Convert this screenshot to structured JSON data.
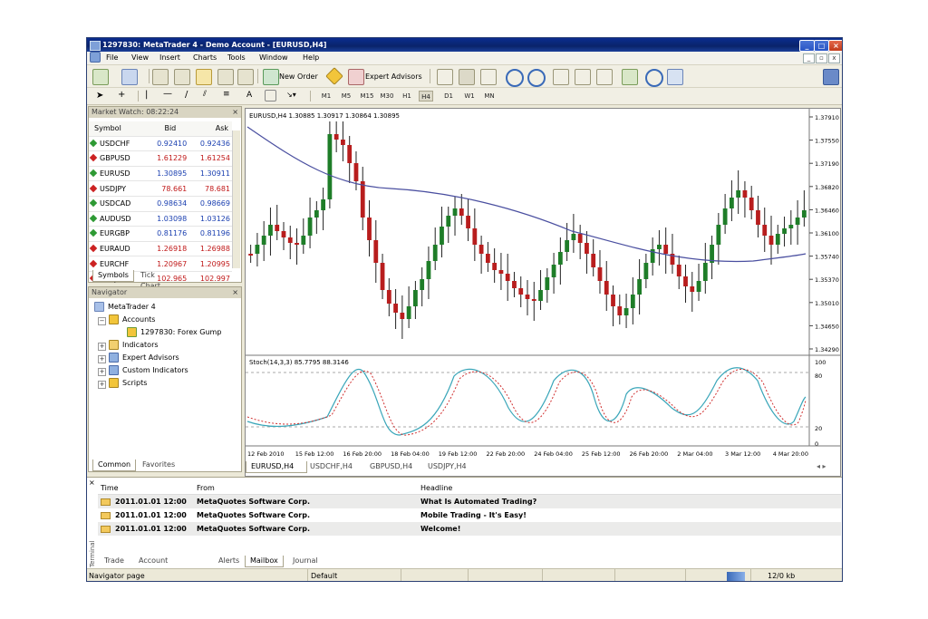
{
  "window": {
    "title": "1297830: MetaTrader 4 - Demo Account - [EURUSD,H4]"
  },
  "menu": [
    "File",
    "View",
    "Insert",
    "Charts",
    "Tools",
    "Window",
    "Help"
  ],
  "toolbar": {
    "new_order": "New Order",
    "expert_advisors": "Expert Advisors"
  },
  "drawing_tools": {
    "text_tool": "A"
  },
  "timeframes": [
    "M1",
    "M5",
    "M15",
    "M30",
    "H1",
    "H4",
    "D1",
    "W1",
    "MN"
  ],
  "active_timeframe": "H4",
  "market_watch": {
    "title": "Market Watch: 08:22:24",
    "columns": [
      "Symbol",
      "Bid",
      "Ask"
    ],
    "rows": [
      {
        "symbol": "USDCHF",
        "bid": "0.92410",
        "ask": "0.92436",
        "dir": "up"
      },
      {
        "symbol": "GBPUSD",
        "bid": "1.61229",
        "ask": "1.61254",
        "dir": "down"
      },
      {
        "symbol": "EURUSD",
        "bid": "1.30895",
        "ask": "1.30911",
        "dir": "up"
      },
      {
        "symbol": "USDJPY",
        "bid": "78.661",
        "ask": "78.681",
        "dir": "down"
      },
      {
        "symbol": "USDCAD",
        "bid": "0.98634",
        "ask": "0.98669",
        "dir": "up"
      },
      {
        "symbol": "AUDUSD",
        "bid": "1.03098",
        "ask": "1.03126",
        "dir": "up"
      },
      {
        "symbol": "EURGBP",
        "bid": "0.81176",
        "ask": "0.81196",
        "dir": "up"
      },
      {
        "symbol": "EURAUD",
        "bid": "1.26918",
        "ask": "1.26988",
        "dir": "down"
      },
      {
        "symbol": "EURCHF",
        "bid": "1.20967",
        "ask": "1.20995",
        "dir": "down"
      },
      {
        "symbol": "EURJPY",
        "bid": "102.965",
        "ask": "102.997",
        "dir": "down"
      }
    ],
    "tabs": [
      "Symbols",
      "Tick Chart"
    ]
  },
  "navigator": {
    "title": "Navigator",
    "items": [
      "MetaTrader 4",
      "Accounts",
      "1297830: Forex Gump",
      "Indicators",
      "Expert Advisors",
      "Custom Indicators",
      "Scripts"
    ],
    "tabs": [
      "Common",
      "Favorites"
    ]
  },
  "chart": {
    "header": "EURUSD,H4  1.30885 1.30917 1.30864 1.30895",
    "indicator_header": "Stoch(14,3,3) 85.7795 88.3146",
    "price_ticks": [
      "1.37910",
      "1.37550",
      "1.37190",
      "1.36820",
      "1.36460",
      "1.36100",
      "1.35740",
      "1.35370",
      "1.35010",
      "1.34650",
      "1.34290"
    ],
    "stoch_ticks": [
      "100",
      "80",
      "20",
      "0"
    ],
    "date_ticks": [
      "12 Feb 2010",
      "15 Feb 12:00",
      "16 Feb 20:00",
      "18 Feb 04:00",
      "19 Feb 12:00",
      "22 Feb 20:00",
      "24 Feb 04:00",
      "25 Feb 12:00",
      "26 Feb 20:00",
      "2 Mar 04:00",
      "3 Mar 12:00",
      "4 Mar 20:00"
    ],
    "tabs": [
      "EURUSD,H4",
      "USDCHF,H4",
      "GBPUSD,H4",
      "USDJPY,H4"
    ],
    "colors": {
      "bull": "#1e7d28",
      "bear": "#b81d1d",
      "ma": "#4a4fa0",
      "stoch_main": "#3aa6b9",
      "stoch_signal": "#d03030"
    }
  },
  "terminal": {
    "columns": [
      "Time",
      "From",
      "Headline"
    ],
    "rows": [
      {
        "time": "2011.01.01 12:00",
        "from": "MetaQuotes Software Corp.",
        "headline": "What Is Automated Trading?"
      },
      {
        "time": "2011.01.01 12:00",
        "from": "MetaQuotes Software Corp.",
        "headline": "Mobile Trading - It's Easy!"
      },
      {
        "time": "2011.01.01 12:00",
        "from": "MetaQuotes Software Corp.",
        "headline": "Welcome!"
      }
    ],
    "tabs": [
      "Trade",
      "Account History",
      "Alerts",
      "Mailbox",
      "Journal"
    ],
    "active_tab": "Mailbox",
    "side_label": "Terminal"
  },
  "status": {
    "left": "Navigator page",
    "profile": "Default",
    "traffic": "12/0 kb"
  }
}
